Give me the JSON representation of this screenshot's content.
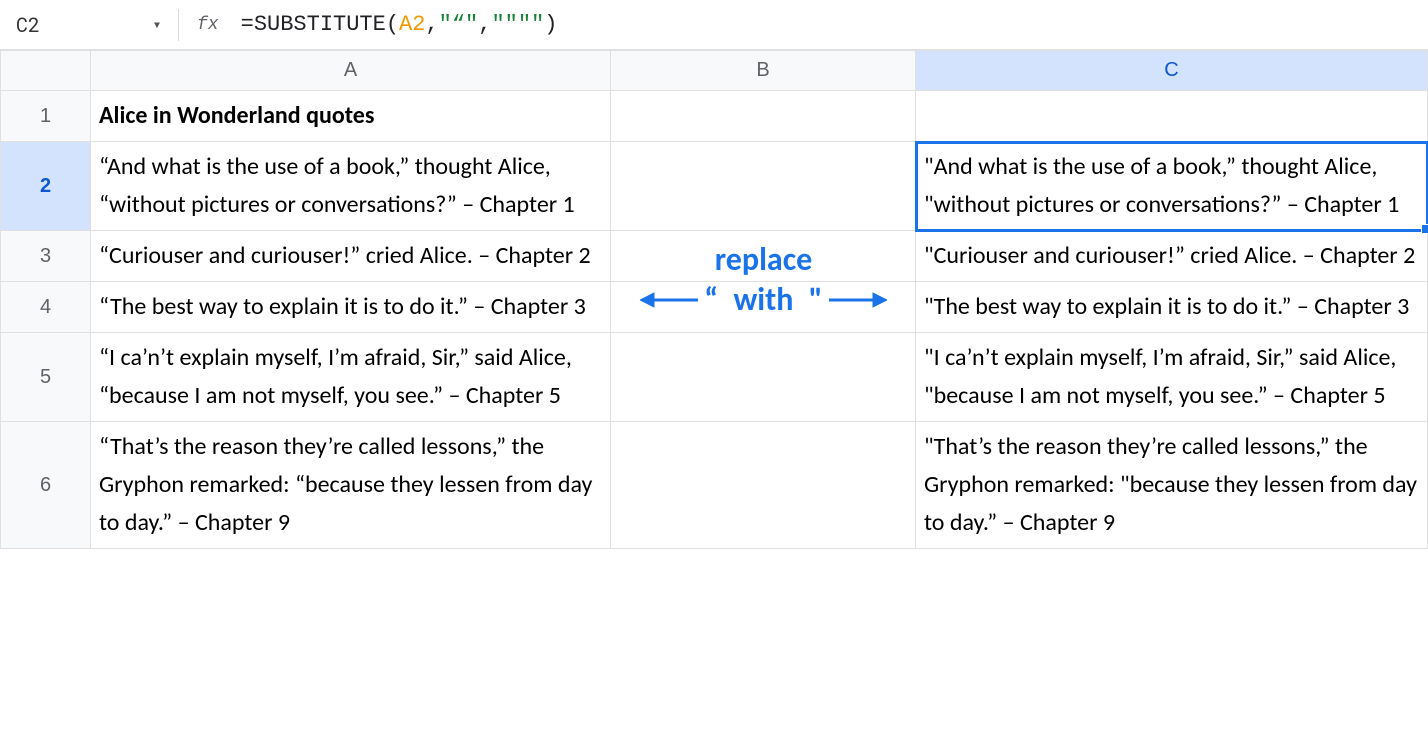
{
  "namebox": {
    "cell_ref": "C2"
  },
  "formula": {
    "prefix": "=",
    "func": "SUBSTITUTE",
    "open": "(",
    "arg_ref": "A2",
    "sep1": ",",
    "arg_str1": "\"“\"",
    "sep2": ",",
    "arg_str2": "\"\"\"\"",
    "close": ")"
  },
  "columns": [
    "A",
    "B",
    "C"
  ],
  "rows": [
    {
      "n": "1",
      "a": "Alice in Wonderland quotes",
      "b": "",
      "c": ""
    },
    {
      "n": "2",
      "a": "“And what is the use of a book,” thought Alice, “without pictures or conversations?” – Chapter 1",
      "b": "",
      "c": "\"And what is the use of a book,” thought Alice, \"without pictures or conversations?” – Chapter 1"
    },
    {
      "n": "3",
      "a": "“Curiouser and curiouser!” cried Alice. – Chapter 2",
      "b": "",
      "c": "\"Curiouser and curiouser!” cried Alice. – Chapter 2"
    },
    {
      "n": "4",
      "a": "“The best way to explain it is to do it.” – Chapter 3",
      "b": "",
      "c": "\"The best way to explain it is to do it.” – Chapter 3"
    },
    {
      "n": "5",
      "a": "“I ca’n’t explain myself, I’m afraid, Sir,” said Alice, “because I am not myself, you see.” – Chapter 5",
      "b": "",
      "c": "\"I ca’n’t explain myself, I’m afraid, Sir,” said Alice, \"because I am not myself, you see.” – Chapter 5"
    },
    {
      "n": "6",
      "a": "“That’s the reason they’re called lessons,” the Gryphon remarked: “because they lessen from day to day.” – Chapter 9",
      "b": "",
      "c": "\"That’s the reason they’re called lessons,” the Gryphon remarked: \"because they lessen from day to day.” – Chapter 9"
    }
  ],
  "selected": {
    "row": 2,
    "col": "C"
  },
  "annotation": {
    "line1": "replace",
    "line2_left": "“",
    "line2_mid": "with",
    "line2_right": "\""
  }
}
